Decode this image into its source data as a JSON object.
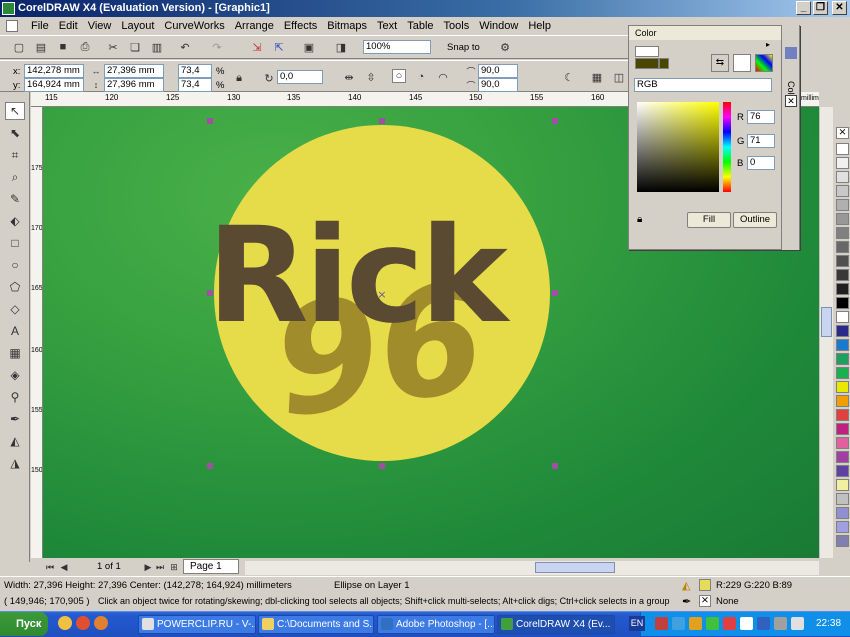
{
  "window": {
    "title": "CorelDRAW X4 (Evaluation Version) - [Graphic1]",
    "buttons": [
      "_",
      "❐",
      "✕"
    ]
  },
  "menu": [
    "File",
    "Edit",
    "View",
    "Layout",
    "CurveWorks",
    "Arrange",
    "Effects",
    "Bitmaps",
    "Text",
    "Table",
    "Tools",
    "Window",
    "Help"
  ],
  "standard_toolbar": {
    "zoom": "100%",
    "snap_to": "Snap to"
  },
  "property_bar": {
    "x": "142,278 mm",
    "y": "164,924 mm",
    "width": "27,396 mm",
    "height": "27,396 mm",
    "scale_x": "73,4",
    "scale_y": "73,4",
    "percent": "%",
    "rotation": "0,0",
    "start_angle": "90,0",
    "end_angle": "90,0"
  },
  "ruler": {
    "top_ticks": [
      "115",
      "120",
      "125",
      "130",
      "135",
      "140",
      "145",
      "150",
      "155",
      "160"
    ],
    "left_ticks": [
      "175",
      "170",
      "165",
      "160",
      "155",
      "150"
    ],
    "unit_top": "millimeters",
    "unit_left": "millimeters"
  },
  "artwork": {
    "main_text": "Rick",
    "secondary_text": "96",
    "circle_color": "#e6dc4a",
    "text_color": "#5a4a32",
    "number_color": "#a08c2a"
  },
  "color_docker": {
    "title": "Color",
    "model": "RGB",
    "r_label": "R",
    "g_label": "G",
    "b_label": "B",
    "r_value": "76",
    "g_value": "71",
    "b_value": "0",
    "fill_button": "Fill",
    "outline_button": "Outline",
    "side_tab": "Color"
  },
  "page_nav": {
    "page_count": "1 of 1",
    "page_tab": "Page 1"
  },
  "status": {
    "dimensions": "Width: 27,396  Height: 27,396  Center: (142,278; 164,924)  millimeters",
    "object_info": "Ellipse on Layer 1",
    "fill_info": "R:229 G:220 B:89",
    "coords": "( 149,946; 170,905 )",
    "hint": "Click an object twice for rotating/skewing; dbl-clicking tool selects all objects; Shift+click multi-selects; Alt+click digs; Ctrl+click selects in a group",
    "outline_info": "None"
  },
  "taskbar": {
    "start": "Пуск",
    "tasks": [
      "POWERCLIP.RU - V-...",
      "C:\\Documents and S...",
      "Adobe Photoshop - [...",
      "CorelDRAW X4 (Ev..."
    ],
    "lang": "EN",
    "clock": "22:38"
  },
  "palette_colors": [
    "#ffffff",
    "#f0f0f0",
    "#e0e0e0",
    "#c8c8c8",
    "#b0b0b0",
    "#989898",
    "#808080",
    "#686868",
    "#505050",
    "#383838",
    "#202020",
    "#000000",
    "#ffffff",
    "#2a2a8a",
    "#1a7ad0",
    "#20a060",
    "#18b050",
    "#e8e800",
    "#f0a000",
    "#e04040",
    "#c02080",
    "#e060a0",
    "#a040a0",
    "#6040a0",
    "#f0f0a0",
    "#c0c0c0",
    "#9090d0",
    "#a0a0e0",
    "#8080b0"
  ]
}
